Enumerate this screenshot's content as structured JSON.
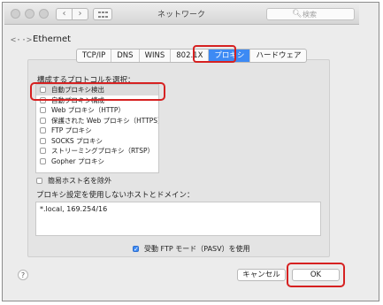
{
  "window": {
    "title": "ネットワーク",
    "search_placeholder": "検索"
  },
  "header": {
    "icon": "ethernet-icon",
    "title": "Ethernet"
  },
  "tabs": [
    {
      "label": "TCP/IP",
      "active": false
    },
    {
      "label": "DNS",
      "active": false
    },
    {
      "label": "WINS",
      "active": false
    },
    {
      "label": "802.1X",
      "active": false
    },
    {
      "label": "プロキシ",
      "active": true
    },
    {
      "label": "ハードウェア",
      "active": false
    }
  ],
  "protocols": {
    "label": "構成するプロトコルを選択：",
    "items": [
      {
        "label": "自動プロキシ検出",
        "checked": false,
        "selected": true
      },
      {
        "label": "自動プロキシ構成",
        "checked": false
      },
      {
        "label": "Web プロキシ（HTTP）",
        "checked": false
      },
      {
        "label": "保護された Web プロキシ（HTTPS）",
        "checked": false
      },
      {
        "label": "FTP プロキシ",
        "checked": false
      },
      {
        "label": "SOCKS プロキシ",
        "checked": false
      },
      {
        "label": "ストリーミングプロキシ（RTSP）",
        "checked": false
      },
      {
        "label": "Gopher プロキシ",
        "checked": false
      }
    ]
  },
  "simple_hostnames": {
    "label": "簡易ホスト名を除外",
    "checked": false
  },
  "bypass": {
    "label": "プロキシ設定を使用しないホストとドメイン：",
    "value": "*.local, 169.254/16"
  },
  "pasv": {
    "label": "受動 FTP モード（PASV）を使用",
    "checked": true
  },
  "buttons": {
    "help": "?",
    "cancel": "キャンセル",
    "ok": "OK"
  },
  "colors": {
    "accent": "#3d8af4",
    "highlight": "#d62121"
  }
}
